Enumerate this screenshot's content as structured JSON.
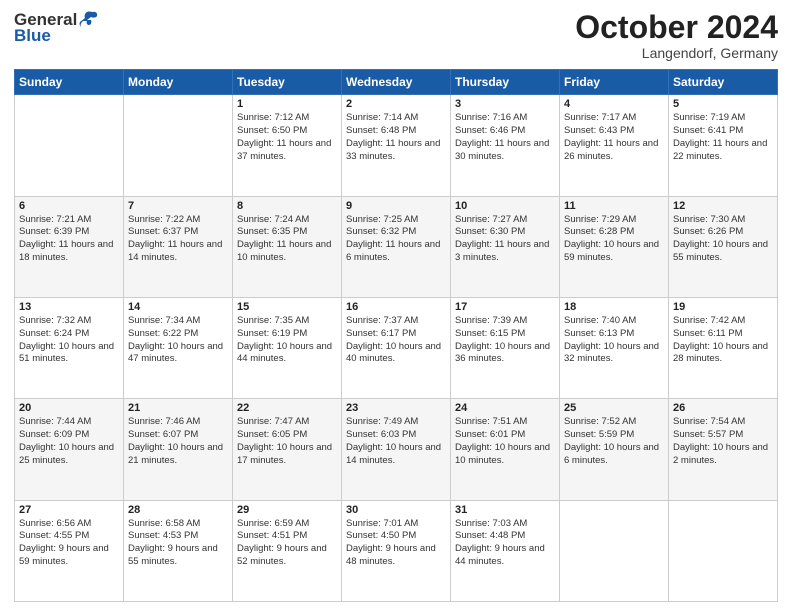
{
  "header": {
    "logo_general": "General",
    "logo_blue": "Blue",
    "month_title": "October 2024",
    "location": "Langendorf, Germany"
  },
  "weekdays": [
    "Sunday",
    "Monday",
    "Tuesday",
    "Wednesday",
    "Thursday",
    "Friday",
    "Saturday"
  ],
  "weeks": [
    [
      {
        "day": "",
        "detail": ""
      },
      {
        "day": "",
        "detail": ""
      },
      {
        "day": "1",
        "detail": "Sunrise: 7:12 AM\nSunset: 6:50 PM\nDaylight: 11 hours\nand 37 minutes."
      },
      {
        "day": "2",
        "detail": "Sunrise: 7:14 AM\nSunset: 6:48 PM\nDaylight: 11 hours\nand 33 minutes."
      },
      {
        "day": "3",
        "detail": "Sunrise: 7:16 AM\nSunset: 6:46 PM\nDaylight: 11 hours\nand 30 minutes."
      },
      {
        "day": "4",
        "detail": "Sunrise: 7:17 AM\nSunset: 6:43 PM\nDaylight: 11 hours\nand 26 minutes."
      },
      {
        "day": "5",
        "detail": "Sunrise: 7:19 AM\nSunset: 6:41 PM\nDaylight: 11 hours\nand 22 minutes."
      }
    ],
    [
      {
        "day": "6",
        "detail": "Sunrise: 7:21 AM\nSunset: 6:39 PM\nDaylight: 11 hours\nand 18 minutes."
      },
      {
        "day": "7",
        "detail": "Sunrise: 7:22 AM\nSunset: 6:37 PM\nDaylight: 11 hours\nand 14 minutes."
      },
      {
        "day": "8",
        "detail": "Sunrise: 7:24 AM\nSunset: 6:35 PM\nDaylight: 11 hours\nand 10 minutes."
      },
      {
        "day": "9",
        "detail": "Sunrise: 7:25 AM\nSunset: 6:32 PM\nDaylight: 11 hours\nand 6 minutes."
      },
      {
        "day": "10",
        "detail": "Sunrise: 7:27 AM\nSunset: 6:30 PM\nDaylight: 11 hours\nand 3 minutes."
      },
      {
        "day": "11",
        "detail": "Sunrise: 7:29 AM\nSunset: 6:28 PM\nDaylight: 10 hours\nand 59 minutes."
      },
      {
        "day": "12",
        "detail": "Sunrise: 7:30 AM\nSunset: 6:26 PM\nDaylight: 10 hours\nand 55 minutes."
      }
    ],
    [
      {
        "day": "13",
        "detail": "Sunrise: 7:32 AM\nSunset: 6:24 PM\nDaylight: 10 hours\nand 51 minutes."
      },
      {
        "day": "14",
        "detail": "Sunrise: 7:34 AM\nSunset: 6:22 PM\nDaylight: 10 hours\nand 47 minutes."
      },
      {
        "day": "15",
        "detail": "Sunrise: 7:35 AM\nSunset: 6:19 PM\nDaylight: 10 hours\nand 44 minutes."
      },
      {
        "day": "16",
        "detail": "Sunrise: 7:37 AM\nSunset: 6:17 PM\nDaylight: 10 hours\nand 40 minutes."
      },
      {
        "day": "17",
        "detail": "Sunrise: 7:39 AM\nSunset: 6:15 PM\nDaylight: 10 hours\nand 36 minutes."
      },
      {
        "day": "18",
        "detail": "Sunrise: 7:40 AM\nSunset: 6:13 PM\nDaylight: 10 hours\nand 32 minutes."
      },
      {
        "day": "19",
        "detail": "Sunrise: 7:42 AM\nSunset: 6:11 PM\nDaylight: 10 hours\nand 28 minutes."
      }
    ],
    [
      {
        "day": "20",
        "detail": "Sunrise: 7:44 AM\nSunset: 6:09 PM\nDaylight: 10 hours\nand 25 minutes."
      },
      {
        "day": "21",
        "detail": "Sunrise: 7:46 AM\nSunset: 6:07 PM\nDaylight: 10 hours\nand 21 minutes."
      },
      {
        "day": "22",
        "detail": "Sunrise: 7:47 AM\nSunset: 6:05 PM\nDaylight: 10 hours\nand 17 minutes."
      },
      {
        "day": "23",
        "detail": "Sunrise: 7:49 AM\nSunset: 6:03 PM\nDaylight: 10 hours\nand 14 minutes."
      },
      {
        "day": "24",
        "detail": "Sunrise: 7:51 AM\nSunset: 6:01 PM\nDaylight: 10 hours\nand 10 minutes."
      },
      {
        "day": "25",
        "detail": "Sunrise: 7:52 AM\nSunset: 5:59 PM\nDaylight: 10 hours\nand 6 minutes."
      },
      {
        "day": "26",
        "detail": "Sunrise: 7:54 AM\nSunset: 5:57 PM\nDaylight: 10 hours\nand 2 minutes."
      }
    ],
    [
      {
        "day": "27",
        "detail": "Sunrise: 6:56 AM\nSunset: 4:55 PM\nDaylight: 9 hours\nand 59 minutes."
      },
      {
        "day": "28",
        "detail": "Sunrise: 6:58 AM\nSunset: 4:53 PM\nDaylight: 9 hours\nand 55 minutes."
      },
      {
        "day": "29",
        "detail": "Sunrise: 6:59 AM\nSunset: 4:51 PM\nDaylight: 9 hours\nand 52 minutes."
      },
      {
        "day": "30",
        "detail": "Sunrise: 7:01 AM\nSunset: 4:50 PM\nDaylight: 9 hours\nand 48 minutes."
      },
      {
        "day": "31",
        "detail": "Sunrise: 7:03 AM\nSunset: 4:48 PM\nDaylight: 9 hours\nand 44 minutes."
      },
      {
        "day": "",
        "detail": ""
      },
      {
        "day": "",
        "detail": ""
      }
    ]
  ]
}
